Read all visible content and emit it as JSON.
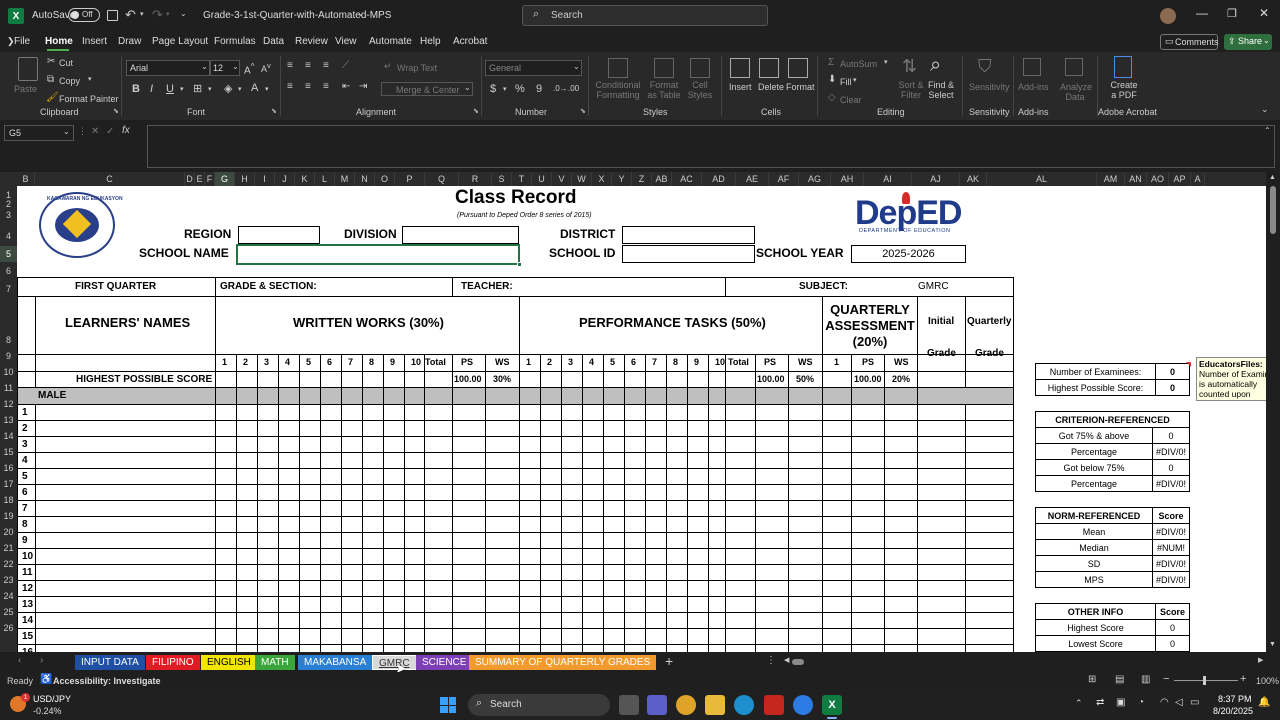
{
  "titlebar": {
    "autosave_label": "AutoSave",
    "autosave_state": "Off",
    "filename": "Grade-3-1st-Quarter-with-Automated-MPS",
    "search_placeholder": "Search"
  },
  "tabs": [
    "File",
    "Home",
    "Insert",
    "Draw",
    "Page Layout",
    "Formulas",
    "Data",
    "Review",
    "View",
    "Automate",
    "Help",
    "Acrobat"
  ],
  "comments_label": "Comments",
  "share_label": "Share",
  "ribbon": {
    "paste": "Paste",
    "cut": "Cut",
    "copy": "Copy",
    "format_painter": "Format Painter",
    "clipboard": "Clipboard",
    "font_name": "Arial",
    "font_size": "12",
    "font": "Font",
    "wrap_text": "Wrap Text",
    "merge_center": "Merge & Center",
    "alignment": "Alignment",
    "number_format": "General",
    "number": "Number",
    "conditional": "Conditional Formatting",
    "format_table": "Format as Table",
    "cell_styles": "Cell Styles",
    "styles": "Styles",
    "insert": "Insert",
    "delete": "Delete",
    "format": "Format",
    "cells": "Cells",
    "autosum": "AutoSum",
    "fill": "Fill",
    "clear": "Clear",
    "sort_filter": "Sort & Filter",
    "find_select": "Find & Select",
    "editing": "Editing",
    "sensitivity": "Sensitivity",
    "addins": "Add-ins",
    "analyze": "Analyze Data",
    "create_pdf": "Create a PDF",
    "adobe": "Adobe Acrobat"
  },
  "namebox": "G5",
  "columns": [
    "A",
    "B",
    "C",
    "D",
    "E",
    "F",
    "G",
    "H",
    "I",
    "J",
    "K",
    "L",
    "M",
    "N",
    "O",
    "P",
    "Q",
    "R",
    "S",
    "T",
    "U",
    "V",
    "W",
    "X",
    "Y",
    "Z",
    "AB",
    "AC",
    "AD",
    "AE",
    "AF",
    "AG",
    "AH",
    "AI",
    "AJ",
    "AK",
    "AL",
    "AM",
    "AN",
    "AO",
    "AP",
    "A"
  ],
  "rows": [
    "1",
    "2",
    "3",
    "4",
    "5",
    "6",
    "7",
    "8",
    "9",
    "10",
    "11",
    "12",
    "13",
    "14",
    "15",
    "16",
    "17",
    "18",
    "19",
    "20",
    "21",
    "22",
    "23",
    "24",
    "25",
    "26"
  ],
  "sheet": {
    "title": "Class Record",
    "subtitle": "(Pursuant to Deped Order 8 series of 2015)",
    "logo_text": "KAGAWARAN NG EDUKASYON",
    "deped_logo": "DepED",
    "deped_sub": "DEPARTMENT OF EDUCATION",
    "region": "REGION",
    "division": "DIVISION",
    "district": "DISTRICT",
    "school_name": "SCHOOL NAME",
    "school_id": "SCHOOL ID",
    "school_year": "SCHOOL YEAR",
    "school_year_value": "2025-2026",
    "first_quarter": "FIRST QUARTER",
    "grade_section": "GRADE & SECTION:",
    "teacher": "TEACHER:",
    "subject": "SUBJECT:",
    "subject_value": "GMRC",
    "learners_names": "LEARNERS' NAMES",
    "written_works": "WRITTEN WORKS (30%)",
    "performance_tasks": "PERFORMANCE TASKS (50%)",
    "quarterly_assessment": "QUARTERLY ASSESSMENT (20%)",
    "initial": "Initial",
    "grade": "Grade",
    "quarterly": "Quarterly",
    "total": "Total",
    "ps": "PS",
    "ws": "WS",
    "qa_num": "1",
    "highest_possible": "HIGHEST POSSIBLE SCORE",
    "ww_ps": "100.00",
    "ww_ws": "30%",
    "pt_ps": "100.00",
    "pt_ws": "50%",
    "qa_ps": "100.00",
    "qa_ws": "20%",
    "male": "MALE",
    "learner_numbers": [
      "1",
      "2",
      "3",
      "4",
      "5",
      "6",
      "7",
      "8",
      "9",
      "10",
      "11",
      "12",
      "13",
      "14",
      "15",
      "16"
    ]
  },
  "stats": {
    "examinees_label": "Number of Examinees:",
    "examinees": "0",
    "hps_label": "Highest Possible Score:",
    "hps": "0",
    "crit_title": "CRITERION-REFERENCED",
    "crit_rows": [
      {
        "label": "Got 75% & above",
        "value": "0"
      },
      {
        "label": "Percentage",
        "value": "#DIV/0!"
      },
      {
        "label": "Got below 75%",
        "value": "0"
      },
      {
        "label": "Percentage",
        "value": "#DIV/0!"
      }
    ],
    "norm_title": "NORM-REFERENCED",
    "score_label": "Score",
    "norm_rows": [
      {
        "label": "Mean",
        "value": "#DIV/0!"
      },
      {
        "label": "Median",
        "value": "#NUM!"
      },
      {
        "label": "SD",
        "value": "#DIV/0!"
      },
      {
        "label": "MPS",
        "value": "#DIV/0!"
      }
    ],
    "other_title": "OTHER INFO",
    "other_rows": [
      {
        "label": "Highest Score",
        "value": "0"
      },
      {
        "label": "Lowest Score",
        "value": "0"
      }
    ]
  },
  "comment_box": {
    "author": "EducatorsFiles:",
    "text1": "Number of Examin",
    "text2": "is automatically",
    "text3": "counted upon"
  },
  "sheet_tabs": [
    {
      "label": "INPUT DATA",
      "color": "#1e4fa3"
    },
    {
      "label": "FILIPINO",
      "color": "#e01b24"
    },
    {
      "label": "ENGLISH",
      "color": "#f2e600"
    },
    {
      "label": "MATH",
      "color": "#3aa53a"
    },
    {
      "label": "MAKABANSA",
      "color": "#2a7fd4"
    },
    {
      "label": "GMRC",
      "color": "#d9d9d9"
    },
    {
      "label": "SCIENCE",
      "color": "#7d3fb5"
    },
    {
      "label": "SUMMARY OF QUARTERLY GRADES",
      "color": "#f29a2e"
    }
  ],
  "status": {
    "ready": "Ready",
    "accessibility": "Accessibility: Investigate",
    "zoom": "100%"
  },
  "taskbar": {
    "ticker": "USD/JPY",
    "change": "-0.24%",
    "search": "Search",
    "time": "8:37 PM",
    "date": "8/20/2025"
  }
}
